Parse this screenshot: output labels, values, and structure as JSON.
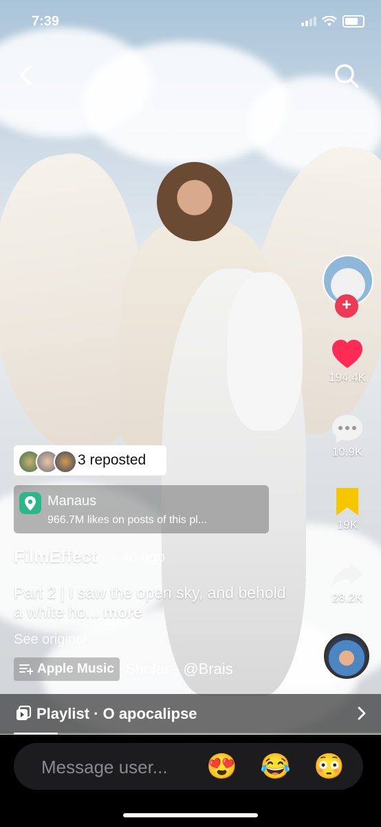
{
  "status_bar": {
    "time": "7:39",
    "icons": [
      "cellular-signal-icon",
      "wifi-icon",
      "battery-icon"
    ]
  },
  "top_bar": {
    "back_icon": "chevron-left-icon",
    "search_icon": "search-icon"
  },
  "side_actions": {
    "follow_icon": "plus-icon",
    "likes": "194.4K",
    "comments": "10.9K",
    "saves": "19K",
    "shares": "28.2K",
    "colors": {
      "like": "#fe2c55",
      "save": "#f7c600",
      "follow": "#ea3a55"
    }
  },
  "repost": {
    "label": "3 reposted"
  },
  "location": {
    "name": "Manaus",
    "subtitle": "966.7M likes on posts of this pl..."
  },
  "post": {
    "author": "FilmEffect",
    "time_ago": "· 4d ago",
    "caption": "Part 2 | I saw the open sky, and behold a white ho...",
    "more_label": "more",
    "see_original": "See original"
  },
  "music": {
    "service": "Apple Music",
    "track": "Shofar - @Brais"
  },
  "playlist": {
    "label": "Playlist · O apocalipse",
    "progress": 0.12
  },
  "composer": {
    "placeholder": "Message user...",
    "emojis": [
      "😍",
      "😂",
      "😳"
    ]
  }
}
